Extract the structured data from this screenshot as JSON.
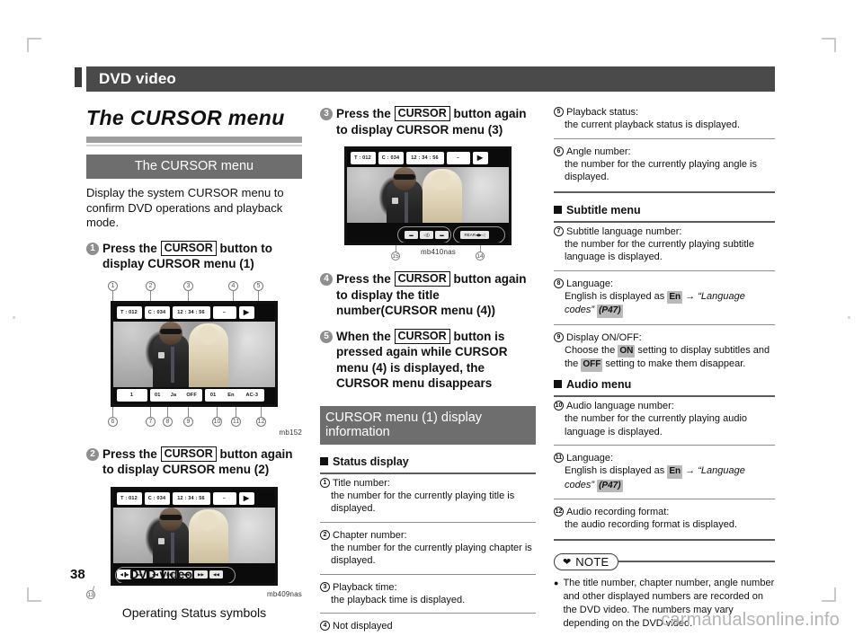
{
  "header": {
    "title": "DVD video"
  },
  "chapter": {
    "title": "The CURSOR menu"
  },
  "section": {
    "heading": "The CURSOR menu"
  },
  "intro": "Display the system CURSOR menu to confirm DVD operations and playback mode.",
  "steps": [
    {
      "num": "1",
      "pre": "Press the",
      "key": "CURSOR",
      "post": "button to display CURSOR menu (1)"
    },
    {
      "num": "2",
      "pre": "Press the",
      "key": "CURSOR",
      "post": "button again to display CURSOR menu (2)"
    },
    {
      "num": "3",
      "pre": "Press the",
      "key": "CURSOR",
      "post": "button again to display CURSOR menu (3)"
    },
    {
      "num": "4",
      "pre": "Press the",
      "key": "CURSOR",
      "post": "button again to display the title number(CURSOR menu (4))"
    },
    {
      "num": "5",
      "pre": "When the",
      "key": "CURSOR",
      "post": "button is pressed again while CURSOR menu (4) is displayed, the CURSOR menu disappears"
    }
  ],
  "screens": {
    "menu1": {
      "callouts_top": [
        "1",
        "2",
        "3",
        "4",
        "5"
      ],
      "callouts_bottom": [
        "6",
        "7",
        "8",
        "9",
        "10",
        "11",
        "12"
      ],
      "top_bar": [
        "T : 012",
        "C : 034",
        "12 : 34 : 56",
        "–",
        "▶"
      ],
      "bottom_bar_group1": [
        "1"
      ],
      "bottom_bar_group2": [
        "01",
        "Ja",
        "OFF"
      ],
      "bottom_bar_group3": [
        "01",
        "En",
        "AC-3"
      ],
      "figcode": "mb152"
    },
    "menu2": {
      "top_bar": [
        "T : 012",
        "C : 034",
        "12 : 34 : 56",
        "–",
        "▶"
      ],
      "op_keys": [
        "◀▐▶",
        "▶▶",
        "◀◀",
        "▶▶|",
        "|◀◀",
        "▶▶",
        "◀◀"
      ],
      "callout": "13",
      "figcode": "mb409nas",
      "caption": "Operating Status symbols"
    },
    "menu3": {
      "top_bar": [
        "T : 012",
        "C : 034",
        "12 : 34 : 56",
        "–",
        "▶"
      ],
      "op_keys_left": [
        "▬",
        "◁))",
        "▬"
      ],
      "op_keys_right": [
        "REAR◀▶◁"
      ],
      "callout_left": "15",
      "callout_right": "14",
      "figcode": "mb410nas"
    }
  },
  "info_section": {
    "heading": "CURSOR menu (1) display information"
  },
  "blocks": [
    {
      "heading": "Status display",
      "items": [
        {
          "num": "1",
          "term": "Title number:",
          "def": "the number for the currently playing title is displayed."
        },
        {
          "num": "2",
          "term": "Chapter number:",
          "def": "the number for the currently playing chapter is displayed."
        },
        {
          "num": "3",
          "term": "Playback time:",
          "def": "the playback time is displayed."
        },
        {
          "num": "4",
          "term": "Not displayed",
          "def": ""
        }
      ]
    }
  ],
  "right_items_top": [
    {
      "num": "5",
      "term": "Playback status:",
      "def": "the current playback status is displayed."
    },
    {
      "num": "6",
      "term": "Angle number:",
      "def": "the number for the currently playing angle is displayed."
    }
  ],
  "subtitle_block": {
    "heading": "Subtitle menu",
    "items": [
      {
        "num": "7",
        "term": "Subtitle language number:",
        "def": "the number for the currently playing subtitle language is displayed."
      },
      {
        "num": "8",
        "term": "Language:",
        "def_pre": "English is displayed as",
        "chip": "En",
        "arrow": "→",
        "link": "“Language codes”",
        "page": "(P47)"
      },
      {
        "num": "9",
        "term": "Display ON/OFF:",
        "def_pre": "Choose the",
        "chip_on": "ON",
        "def_mid": "setting to display subtitles and the",
        "chip_off": "OFF",
        "def_post": "setting to make them disappear."
      }
    ]
  },
  "audio_block": {
    "heading": "Audio menu",
    "items": [
      {
        "num": "10",
        "term": "Audio language number:",
        "def": "the number for the currently playing audio language is displayed."
      },
      {
        "num": "11",
        "term": "Language:",
        "def_pre": "English is displayed as",
        "chip": "En",
        "arrow": "→",
        "link": "“Language codes”",
        "page": "(P47)"
      },
      {
        "num": "12",
        "term": "Audio recording format:",
        "def": "the audio recording format is displayed."
      }
    ]
  },
  "note": {
    "label": "NOTE",
    "icon": "❤",
    "text": "The title number, chapter number, angle number and other displayed numbers are recorded on the DVD video. The numbers may vary depending on the DVD video."
  },
  "footer": {
    "page": "38",
    "title": "DVD video"
  },
  "watermark": "carmanualsonline.info"
}
